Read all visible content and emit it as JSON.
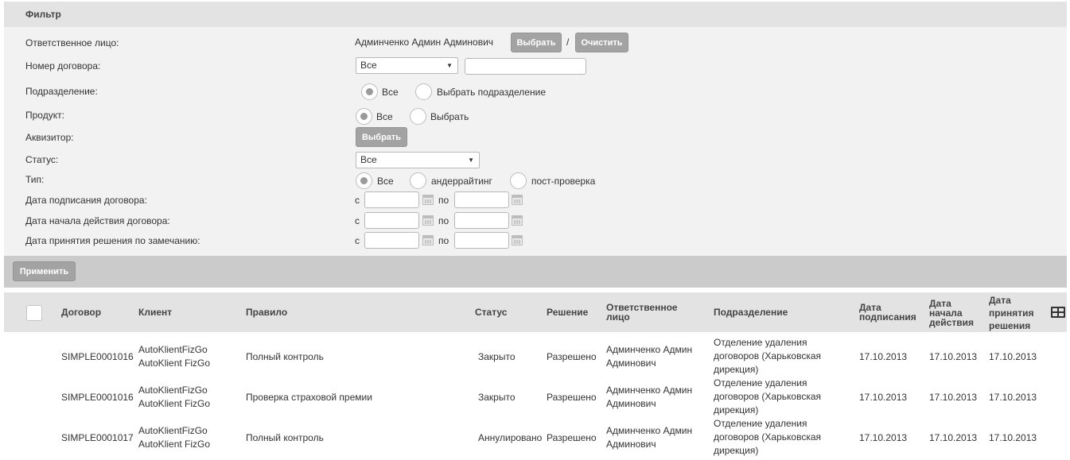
{
  "filter": {
    "title": "Фильтр",
    "responsible": {
      "label": "Ответственное лицо:",
      "value": "Админченко Админ Админович",
      "select_btn": "Выбрать",
      "separator": "/",
      "clear_btn": "Очистить"
    },
    "contract_number": {
      "label": "Номер договора:",
      "select_value": "Все",
      "input_value": ""
    },
    "department": {
      "label": "Подразделение:",
      "options": [
        "Все",
        "Выбрать подразделение"
      ],
      "selected": "Все"
    },
    "product": {
      "label": "Продукт:",
      "options": [
        "Все",
        "Выбрать"
      ],
      "selected": "Все"
    },
    "acquirer": {
      "label": "Аквизитор:",
      "select_btn": "Выбрать"
    },
    "status": {
      "label": "Статус:",
      "select_value": "Все"
    },
    "type": {
      "label": "Тип:",
      "options": [
        "Все",
        "андеррайтинг",
        "пост-проверка"
      ],
      "selected": "Все"
    },
    "date_from_label": "с",
    "date_to_label": "по",
    "dates": [
      {
        "label": "Дата подписания договора:",
        "from": "",
        "to": ""
      },
      {
        "label": "Дата начала действия договора:",
        "from": "",
        "to": ""
      },
      {
        "label": "Дата принятия решения по замечанию:",
        "from": "",
        "to": ""
      }
    ],
    "apply_btn": "Применить"
  },
  "table": {
    "columns": {
      "contract": "Договор",
      "client": "Клиент",
      "rule": "Правило",
      "status": "Статус",
      "decision": "Решение",
      "responsible": [
        "Ответственное",
        "лицо"
      ],
      "department": "Подразделение",
      "sign_date": [
        "Дата",
        "подписания"
      ],
      "start_date": [
        "Дата",
        "начала",
        "действия"
      ],
      "decision_date": [
        "Дата",
        "принятия",
        "решения"
      ]
    },
    "rows": [
      {
        "contract": "SIMPLE0001016",
        "client": [
          "AutoKlientFizGo",
          "AutoKlient FizGo"
        ],
        "rule": "Полный контроль",
        "status": "Закрыто",
        "decision": "Разрешено",
        "responsible": [
          "Админченко Админ",
          "Админович"
        ],
        "department": [
          "Отделение удаления",
          "договоров (Харьковская",
          "дирекция)"
        ],
        "sign_date": "17.10.2013",
        "start_date": "17.10.2013",
        "decision_date": "17.10.2013"
      },
      {
        "contract": "SIMPLE0001016",
        "client": [
          "AutoKlientFizGo",
          "AutoKlient FizGo"
        ],
        "rule": "Проверка страховой премии",
        "status": "Закрыто",
        "decision": "Разрешено",
        "responsible": [
          "Админченко Админ",
          "Админович"
        ],
        "department": [
          "Отделение удаления",
          "договоров (Харьковская",
          "дирекция)"
        ],
        "sign_date": "17.10.2013",
        "start_date": "17.10.2013",
        "decision_date": "17.10.2013"
      },
      {
        "contract": "SIMPLE0001017",
        "client": [
          "AutoKlientFizGo",
          "AutoKlient FizGo"
        ],
        "rule": "Полный контроль",
        "status": "Аннулировано",
        "decision": "Разрешено",
        "responsible": [
          "Админченко Админ",
          "Админович"
        ],
        "department": [
          "Отделение удаления",
          "договоров (Харьковская",
          "дирекция)"
        ],
        "sign_date": "17.10.2013",
        "start_date": "17.10.2013",
        "decision_date": "17.10.2013"
      }
    ]
  },
  "icons": {
    "select_arrow": "triangle-down-icon",
    "calendar": "calendar-icon",
    "column_settings": "table-columns-icon"
  }
}
